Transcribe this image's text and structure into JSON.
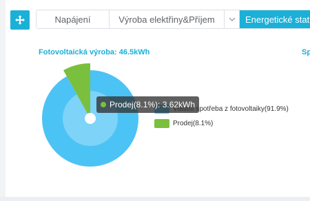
{
  "toolbar": {
    "move_icon": "move-arrows-icon"
  },
  "tabs": [
    {
      "label": "Napájení",
      "active": false
    },
    {
      "label": "Výroba elektřiny&Příjem",
      "active": false
    },
    {
      "label": "Energetické statis",
      "active": true
    }
  ],
  "section": {
    "title": "Fotovoltaická výroba: 46.5kWh",
    "title_right": "Sp"
  },
  "chart_data": {
    "type": "pie",
    "slices": [
      {
        "label": "Vlastní spotřeba z fotovoltaiky",
        "percent": 91.9,
        "color": "#4cc3f5"
      },
      {
        "label": "Prodej",
        "percent": 8.1,
        "value_kwh": 3.62,
        "color": "#7bbf3e"
      }
    ],
    "legend": [
      {
        "text": "Vlastní spotřeba z fotovoltaiky(91.9%)",
        "color": "#4cc3f5"
      },
      {
        "text": "Prodej(8.1%)",
        "color": "#7bbf3e"
      }
    ],
    "tooltip": "Prodej(8.1%): 3.62kWh"
  }
}
